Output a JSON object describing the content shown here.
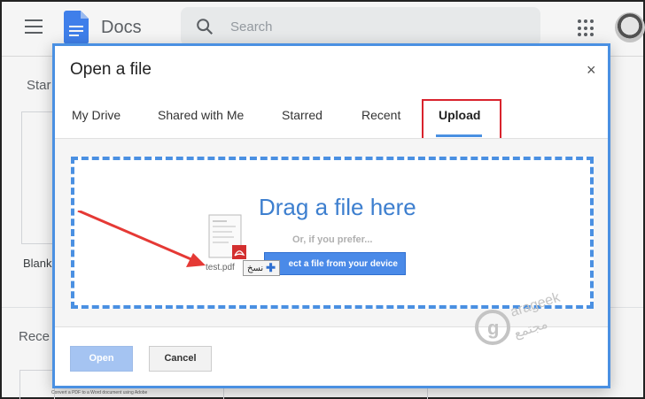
{
  "app": {
    "name": "Docs",
    "search_placeholder": "Search"
  },
  "background": {
    "start_label": "Star",
    "blank_label": "Blank",
    "recent_label": "Rece",
    "recent_doc_snippet": "Convert a PDF to a Word document using Adobe"
  },
  "dialog": {
    "title": "Open a file",
    "close_glyph": "×",
    "tabs": [
      {
        "label": "My Drive"
      },
      {
        "label": "Shared with Me"
      },
      {
        "label": "Starred"
      },
      {
        "label": "Recent"
      },
      {
        "label": "Upload",
        "active": true
      }
    ],
    "drop_title": "Drag a file here",
    "or_prefer": "Or, if you prefer...",
    "select_button": "ect a file from your device",
    "drag_filename": "test.pdf",
    "copy_tooltip": "نسخ",
    "open_button": "Open",
    "cancel_button": "Cancel"
  },
  "watermark": {
    "latin": "arageek",
    "arabic": "مجتمع"
  },
  "colors": {
    "accent": "#4a90e2",
    "highlight": "#d9232d",
    "arrow": "#e53935"
  }
}
